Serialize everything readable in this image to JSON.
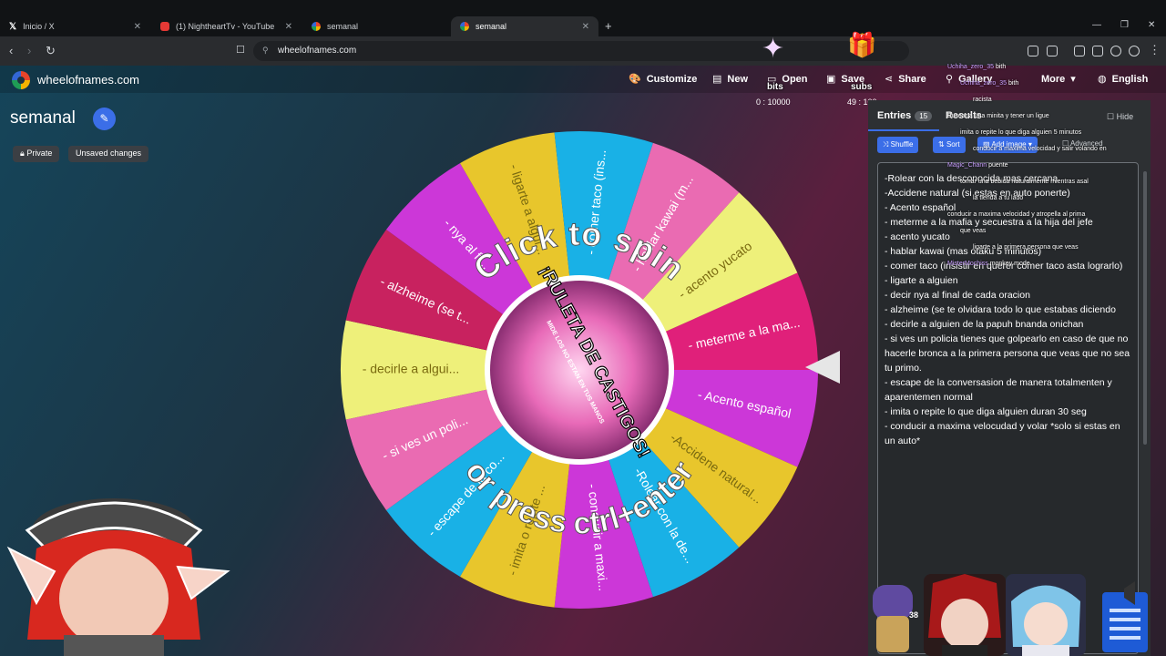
{
  "browser": {
    "tabs": [
      {
        "title": "Inicio / X",
        "icon": "x-logo-icon",
        "active": false
      },
      {
        "title": "(1) NightheartTv - YouTube",
        "icon": "youtube-icon",
        "active": false
      },
      {
        "title": "semanal",
        "icon": "wheel-favicon-icon",
        "active": false
      },
      {
        "title": "semanal",
        "icon": "wheel-favicon-icon",
        "active": true
      }
    ],
    "url": "wheelofnames.com"
  },
  "header": {
    "site_name": "wheelofnames.com",
    "buttons": {
      "customize": "Customize",
      "new": "New",
      "open": "Open",
      "save": "Save",
      "share": "Share",
      "gallery": "Gallery",
      "more": "More",
      "language": "English"
    }
  },
  "wheel_page": {
    "title": "semanal",
    "chips": {
      "private": "Private",
      "unsaved": "Unsaved changes"
    },
    "click_to_spin": "Click to spin",
    "or_press": "or press ctrl+enter",
    "center_title": "¡RULETA DE CASTIGOS!",
    "center_subtitle": "MIDE LOS NO ESTAN EN TUS MANOS",
    "segments": [
      {
        "label": "- meterme a la ma...",
        "color": "#e0207a"
      },
      {
        "label": "- Acento español",
        "color": "#cc37d8"
      },
      {
        "label": "-Accidene natural...",
        "color": "#e8c62c"
      },
      {
        "label": "-Rolear con la de...",
        "color": "#19b1e6"
      },
      {
        "label": "- conducir a maxi...",
        "color": "#cc37d8"
      },
      {
        "label": "- imita o repite ...",
        "color": "#e8c62c"
      },
      {
        "label": "- escape de la co...",
        "color": "#19b1e6"
      },
      {
        "label": "- si ves un poli...",
        "color": "#ea6bb2"
      },
      {
        "label": "- decirle a algui...",
        "color": "#eef07a"
      },
      {
        "label": "- alzheime (se t...",
        "color": "#c8225f"
      },
      {
        "label": "- nya al fi...",
        "color": "#cc37d8"
      },
      {
        "label": "- ligarte a algui...",
        "color": "#e8c62c"
      },
      {
        "label": "- comer taco (ins...",
        "color": "#19b1e6"
      },
      {
        "label": "- hablar kawai (m...",
        "color": "#ea6bb2"
      },
      {
        "label": "- acento yucato",
        "color": "#eef07a"
      }
    ]
  },
  "panel": {
    "tabs": {
      "entries": "Entries",
      "entries_count": "15",
      "results": "Results"
    },
    "hide": "Hide",
    "buttons": {
      "shuffle": "Shuffle",
      "sort": "Sort",
      "add_image": "Add image",
      "advanced": "Advanced"
    },
    "entries": [
      "-Rolear con la desconocida mas cercana",
      "-Accidene natural (si estas en auto ponerte)",
      "- Acento español",
      "- meterme a la mafia y secuestra a la hija del jefe",
      "- acento yucato",
      "- hablar kawai (mas otaku 5 minutos)",
      "- comer taco (insistir en querer comer taco asta lograrlo)",
      "- ligarte a alguien",
      "- decir nya al final de cada oracion",
      "- alzheime (se te olvidara todo lo que estabas diciendo",
      "- decirle a alguien de la papuh bnanda onichan",
      "-  si ves un policia tienes que golpearlo en caso de que no hacerle bronca a la primera persona que veas que no sea tu primo.",
      "- escape de la conversasion de manera totalmenten y aparentemen normal",
      "- imita o repite lo que diga alguien duran 30 seg",
      "- conducir a maxima velocudad y volar *solo si estas en un auto*"
    ]
  },
  "overlay": {
    "bits_label": "bits",
    "bits_value": "0 : 10000",
    "subs_label": "subs",
    "subs_value": "49 : 100",
    "small_num": "38",
    "chat": [
      {
        "name": "Uchiha_zero_35",
        "msg": "bith"
      },
      {
        "name": "Uchiha_zero_35",
        "msg": "bith"
      },
      {
        "name": "",
        "msg": "racista"
      },
      {
        "name": "",
        "msg": "Buscar a una minita y tener un ligue"
      },
      {
        "name": "",
        "msg": "imita o repite lo que diga alguien 5 minutos"
      },
      {
        "name": "",
        "msg": "conducir a maxima velocidad y salir volando en"
      },
      {
        "name": "Magic_Chann",
        "msg": "puente"
      },
      {
        "name": "",
        "msg": "tomar una bebida naturalmente mientras asal"
      },
      {
        "name": "",
        "msg": "la tienda a tu lado"
      },
      {
        "name": "",
        "msg": "conducir a maxima velocidad y atropella al prima"
      },
      {
        "name": "",
        "msg": "que veas"
      },
      {
        "name": "",
        "msg": "ligarte a la primera persona que veas"
      },
      {
        "name": "MisterMochiss",
        "msg": "monkey mode"
      }
    ]
  },
  "colors": {
    "accent": "#3b6ee8",
    "panel_bg": "#2d3033",
    "browser_bg": "#111315"
  }
}
